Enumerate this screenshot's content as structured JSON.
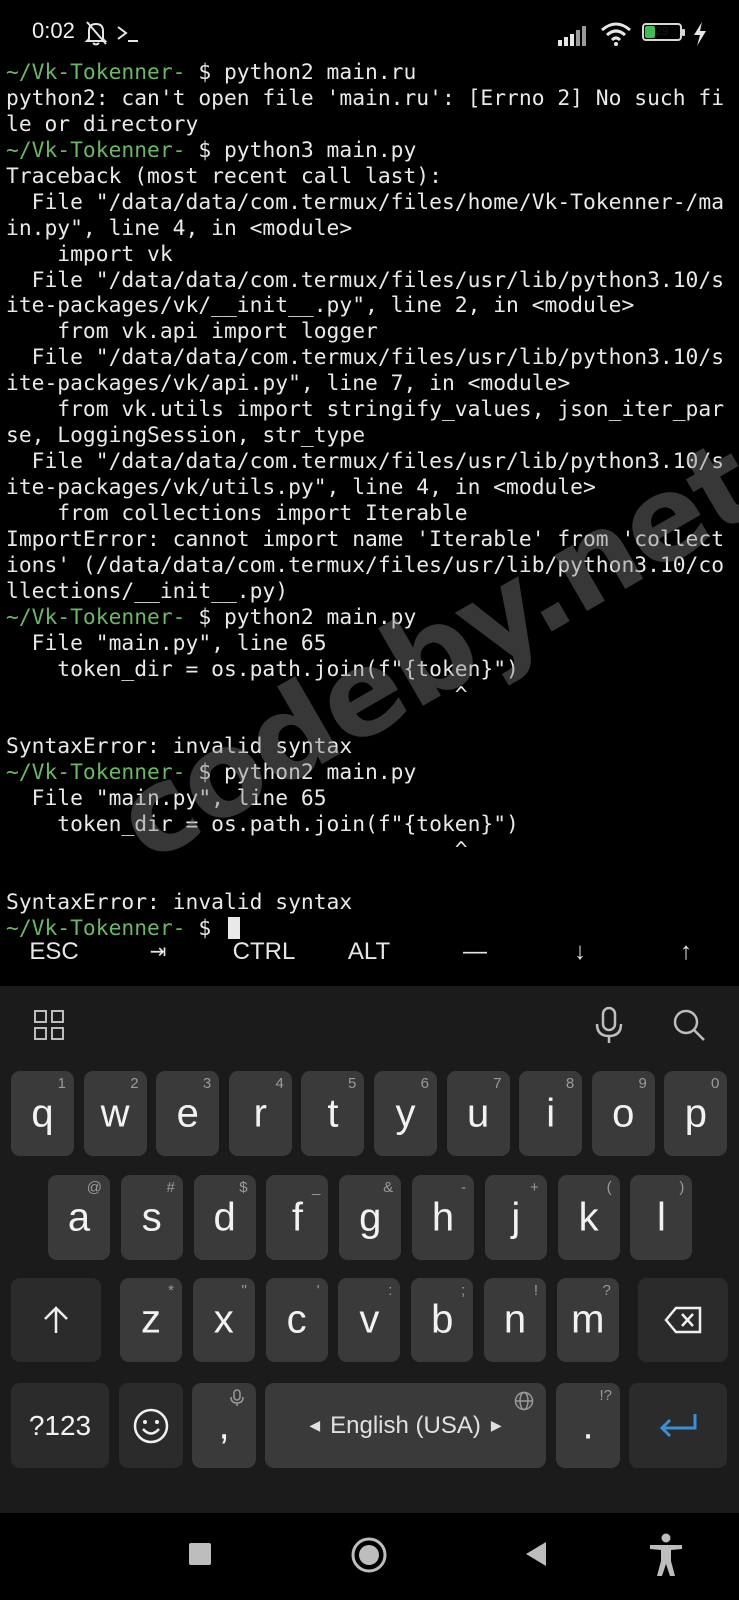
{
  "status_bar": {
    "time": "0:02",
    "icons": [
      "mute-bell-icon",
      "terminal-prompt-icon",
      "signal-icon",
      "wifi-icon",
      "battery-icon",
      "charging-icon"
    ],
    "battery_level": "29",
    "battery_color": "#3fbf4f"
  },
  "terminal": {
    "prompt_path": "~/Vk-Tokenner-",
    "prompt_symbol": "$",
    "path_color": "#6ab866",
    "lines": [
      {
        "prompt": "~/Vk-Tokenner-",
        "text": " $ python2 main.ru"
      },
      {
        "prompt": "",
        "text": "python2: can't open file 'main.ru': [Errno 2] No such fi"
      },
      {
        "prompt": "",
        "text": "le or directory"
      },
      {
        "prompt": "~/Vk-Tokenner-",
        "text": " $ python3 main.py"
      },
      {
        "prompt": "",
        "text": "Traceback (most recent call last):"
      },
      {
        "prompt": "",
        "text": "  File \"/data/data/com.termux/files/home/Vk-Tokenner-/ma"
      },
      {
        "prompt": "",
        "text": "in.py\", line 4, in <module>"
      },
      {
        "prompt": "",
        "text": "    import vk"
      },
      {
        "prompt": "",
        "text": "  File \"/data/data/com.termux/files/usr/lib/python3.10/s"
      },
      {
        "prompt": "",
        "text": "ite-packages/vk/__init__.py\", line 2, in <module>"
      },
      {
        "prompt": "",
        "text": "    from vk.api import logger"
      },
      {
        "prompt": "",
        "text": "  File \"/data/data/com.termux/files/usr/lib/python3.10/s"
      },
      {
        "prompt": "",
        "text": "ite-packages/vk/api.py\", line 7, in <module>"
      },
      {
        "prompt": "",
        "text": "    from vk.utils import stringify_values, json_iter_par"
      },
      {
        "prompt": "",
        "text": "se, LoggingSession, str_type"
      },
      {
        "prompt": "",
        "text": "  File \"/data/data/com.termux/files/usr/lib/python3.10/s"
      },
      {
        "prompt": "",
        "text": "ite-packages/vk/utils.py\", line 4, in <module>"
      },
      {
        "prompt": "",
        "text": "    from collections import Iterable"
      },
      {
        "prompt": "",
        "text": "ImportError: cannot import name 'Iterable' from 'collect"
      },
      {
        "prompt": "",
        "text": "ions' (/data/data/com.termux/files/usr/lib/python3.10/co"
      },
      {
        "prompt": "",
        "text": "llections/__init__.py)"
      },
      {
        "prompt": "~/Vk-Tokenner-",
        "text": " $ python2 main.py"
      },
      {
        "prompt": "",
        "text": "  File \"main.py\", line 65"
      },
      {
        "prompt": "",
        "text": "    token_dir = os.path.join(f\"{token}\")"
      },
      {
        "prompt": "",
        "text": "                                   ^"
      },
      {
        "prompt": "",
        "text": ""
      },
      {
        "prompt": "",
        "text": "SyntaxError: invalid syntax"
      },
      {
        "prompt": "~/Vk-Tokenner-",
        "text": " $ python2 main.py"
      },
      {
        "prompt": "",
        "text": "  File \"main.py\", line 65"
      },
      {
        "prompt": "",
        "text": "    token_dir = os.path.join(f\"{token}\")"
      },
      {
        "prompt": "",
        "text": "                                   ^"
      },
      {
        "prompt": "",
        "text": ""
      },
      {
        "prompt": "",
        "text": "SyntaxError: invalid syntax"
      },
      {
        "prompt": "~/Vk-Tokenner-",
        "text": " $ "
      }
    ]
  },
  "watermark": "codeby.net",
  "extra_keys": [
    "ESC",
    "⇥",
    "CTRL",
    "ALT",
    "—",
    "↓",
    "↑"
  ],
  "keyboard": {
    "toolbar_icons": [
      "apps-grid-icon",
      "microphone-icon",
      "search-icon"
    ],
    "row1": [
      {
        "key": "q",
        "hint": "1"
      },
      {
        "key": "w",
        "hint": "2"
      },
      {
        "key": "e",
        "hint": "3"
      },
      {
        "key": "r",
        "hint": "4"
      },
      {
        "key": "t",
        "hint": "5"
      },
      {
        "key": "y",
        "hint": "6"
      },
      {
        "key": "u",
        "hint": "7"
      },
      {
        "key": "i",
        "hint": "8"
      },
      {
        "key": "o",
        "hint": "9"
      },
      {
        "key": "p",
        "hint": "0"
      }
    ],
    "row2": [
      {
        "key": "a",
        "hint": "@"
      },
      {
        "key": "s",
        "hint": "#"
      },
      {
        "key": "d",
        "hint": "$"
      },
      {
        "key": "f",
        "hint": "_"
      },
      {
        "key": "g",
        "hint": "&"
      },
      {
        "key": "h",
        "hint": "-"
      },
      {
        "key": "j",
        "hint": "+"
      },
      {
        "key": "k",
        "hint": "("
      },
      {
        "key": "l",
        "hint": ")"
      }
    ],
    "row3": [
      {
        "key": "z",
        "hint": "*"
      },
      {
        "key": "x",
        "hint": "\""
      },
      {
        "key": "c",
        "hint": "'"
      },
      {
        "key": "v",
        "hint": ":"
      },
      {
        "key": "b",
        "hint": ";"
      },
      {
        "key": "n",
        "hint": "!"
      },
      {
        "key": "m",
        "hint": "?"
      }
    ],
    "symbols_label": "?123",
    "comma_label": ",",
    "space_label": "English (USA)",
    "period_label": ".",
    "period_hint": "!?",
    "enter_color": "#3a8fd6"
  },
  "navbar": {
    "icons": [
      "recent-apps-square-icon",
      "home-circle-icon",
      "back-triangle-icon",
      "accessibility-icon"
    ]
  }
}
